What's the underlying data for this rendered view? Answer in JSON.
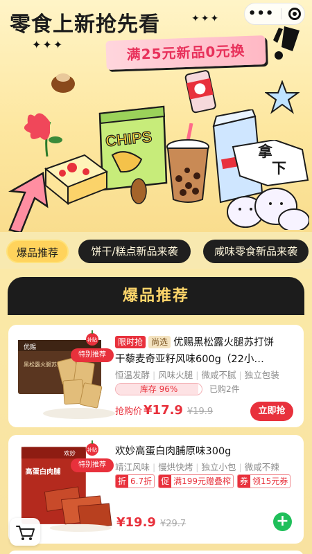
{
  "hero": {
    "title": "零食上新抢先看",
    "sparkles_right": "✦✦✦",
    "sparkles_left": "✦✦✦",
    "promo": "满25元新品0元换",
    "chips_text": "CHIPS",
    "bread_text_line1": "拿",
    "bread_text_line2": "下"
  },
  "capsule": {
    "more": "•••",
    "close": "close"
  },
  "tabs": [
    "爆品推荐",
    "饼干/糕点新品来袭",
    "咸味零食新品来袭"
  ],
  "section": {
    "title": "爆品推荐"
  },
  "products": [
    {
      "tag_limit": "限时抢",
      "tag_select": "尚选",
      "badge": "特别推荐",
      "badge_small": "补贴",
      "pack_brand": "优赐",
      "pack_name": "黑松露火腿苏打饼干",
      "title_rest": "优赐黑松露火腿苏打饼",
      "title_line2": "干藜麦奇亚籽风味600g（22小…",
      "features": [
        "恒温发酵",
        "风味火腿",
        "微咸不腻",
        "独立包装"
      ],
      "stock_text": "库存 96%",
      "stock_fraction": 0.96,
      "purchased": "已购2件",
      "price_label": "抢购价",
      "price_now": "¥17.9",
      "price_old": "¥19.9",
      "button": "立即抢"
    },
    {
      "title": "欢妙高蛋白肉脯原味300g",
      "badge": "特别推荐",
      "badge_small": "补贴",
      "pack_brand": "欢妙",
      "pack_name": "高蛋白肉脯",
      "features": [
        "靖江风味",
        "慢烘快烤",
        "独立小包",
        "微咸不辣"
      ],
      "coupons": [
        {
          "k": "折",
          "v": "6.7折"
        },
        {
          "k": "促",
          "v": "满199元赠叠榨"
        },
        {
          "k": "券",
          "v": "领15元券"
        }
      ],
      "price_now": "¥19.9",
      "price_old": "¥29.7",
      "button": "+"
    }
  ],
  "colors": {
    "accent": "#e8313c",
    "tab_active": "#ffd35c",
    "section_head": "#1c1c1c",
    "add_green": "#1fbf5a"
  }
}
